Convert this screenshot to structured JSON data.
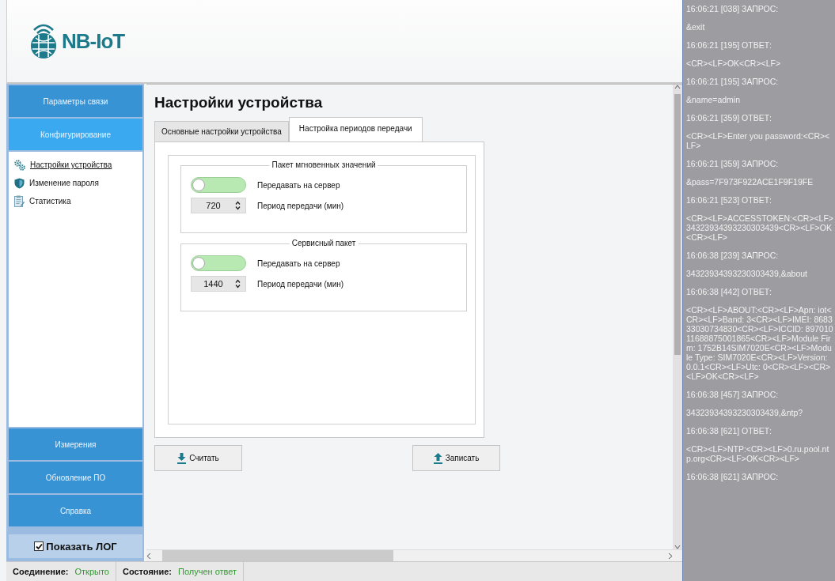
{
  "logo": {
    "text": "NB-IoT"
  },
  "sidebar": {
    "top_items": [
      {
        "label": "Параметры связи",
        "selected": false
      },
      {
        "label": "Конфигурирование",
        "selected": true
      }
    ],
    "sub_items": [
      {
        "label": "Настройки устройства",
        "kind": "gear",
        "selected": true
      },
      {
        "label": "Изменение пароля",
        "kind": "shield",
        "selected": false
      },
      {
        "label": "Статистика",
        "kind": "report",
        "selected": false
      }
    ],
    "bottom_items": [
      {
        "label": "Измерения",
        "selected": false
      },
      {
        "label": "Обновление ПО",
        "selected": false
      },
      {
        "label": "Справка",
        "selected": false
      }
    ],
    "show_log": {
      "label": "Показать ЛОГ",
      "checked": true
    }
  },
  "main": {
    "title": "Настройки устройства",
    "tabs": [
      {
        "label": "Основные настройки устройства",
        "selected": false
      },
      {
        "label": "Настройка периодов передачи",
        "selected": true
      }
    ],
    "groups": [
      {
        "title": "Пакет мгновенных значений",
        "toggle": {
          "label": "Передавать на сервер",
          "on": false
        },
        "period": {
          "value": "720",
          "label": "Период передачи (мин)"
        }
      },
      {
        "title": "Сервисный пакет",
        "toggle": {
          "label": "Передавать на сервер",
          "on": false
        },
        "period": {
          "value": "1440",
          "label": "Период передачи (мин)"
        }
      }
    ],
    "buttons": [
      {
        "label": "Считать",
        "kind": "read"
      },
      {
        "label": "Записать",
        "kind": "write"
      }
    ]
  },
  "status_bar": [
    {
      "label": "Соединение:",
      "value": "Открыто"
    },
    {
      "label": "Состояние:",
      "value": "Получен ответ"
    }
  ],
  "log": [
    "16:06:21 [038] ЗАПРОС:",
    "&exit",
    "16:06:21 [195] ОТВЕТ:",
    "<CR><LF>OK<CR><LF>",
    "16:06:21 [195] ЗАПРОС:",
    "&name=admin",
    "16:06:21 [359] ОТВЕТ:",
    "<CR><LF>Enter you password:<CR><LF>",
    "16:06:21 [359] ЗАПРОС:",
    "&pass=7F973F922ACE1F9F19FE",
    "16:06:21 [523] ОТВЕТ:",
    "<CR><LF>ACCESSTOKEN:<CR><LF>34323934393230303439<CR><LF>OK<CR><LF>",
    "16:06:38 [239] ЗАПРОС:",
    "34323934393230303439,&about",
    "16:06:38 [442] ОТВЕТ:",
    "<CR><LF>ABOUT:<CR><LF>Apn: iot<CR><LF>Band: 3<CR><LF>IMEI: 868333030734830<CR><LF>ICCID: 89701011688875001865<CR><LF>Module Firm: 1752B14SIM7020E<CR><LF>Module Type: SIM7020E<CR><LF>Version: 0.0.1<CR><LF>Utc: 0<CR><LF><CR><LF>OK<CR><LF>",
    "16:06:38 [457] ЗАПРОС:",
    "34323934393230303439,&ntp?",
    "16:06:38 [621] ОТВЕТ:",
    "<CR><LF>NTP:<CR><LF>0.ru.pool.ntp.org<CR><LF>OK<CR><LF>",
    "16:06:38 [621] ЗАПРОС:"
  ]
}
